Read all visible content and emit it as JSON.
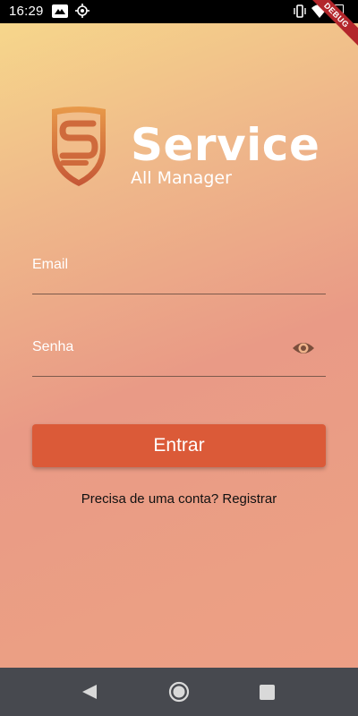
{
  "status_bar": {
    "time": "16:29",
    "debug_banner": "DEBUG"
  },
  "logo": {
    "title": "Service",
    "subtitle": "All Manager",
    "colors": {
      "shield_light": "#e89a4a",
      "shield_dark": "#c55636"
    }
  },
  "form": {
    "email_label": "Email",
    "email_value": "",
    "password_label": "Senha",
    "password_value": "",
    "password_toggle_icon": "eye-icon",
    "submit_label": "Entrar",
    "register_text": "Precisa de uma conta? Registrar"
  },
  "colors": {
    "button": "#db5a38",
    "background_top": "#f7da8b",
    "background_bottom": "#ee9f86",
    "nav_bar": "#47494f"
  },
  "nav_bar": {
    "icons": [
      "back-icon",
      "home-icon",
      "recents-icon"
    ]
  }
}
